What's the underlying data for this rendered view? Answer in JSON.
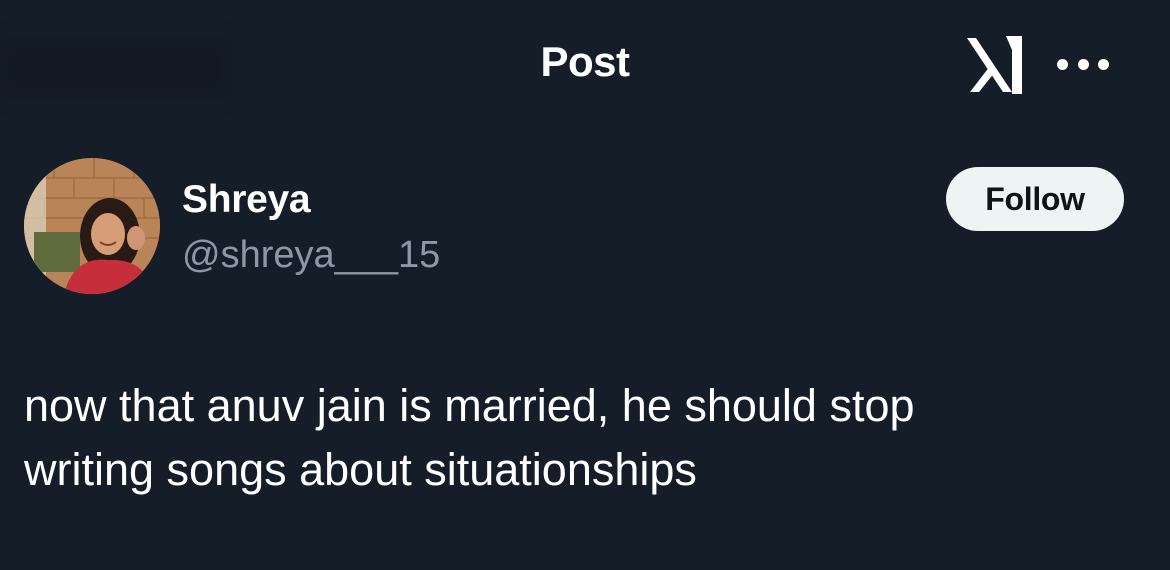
{
  "header": {
    "title": "Post",
    "logo_icon": "x-logo-icon",
    "more_icon": "more-options-icon"
  },
  "author": {
    "display_name": "Shreya",
    "handle": "@shreya___15",
    "avatar_icon": "profile-photo"
  },
  "actions": {
    "follow_label": "Follow"
  },
  "post": {
    "text_lines": [
      "now that anuv jain is married, he should stop",
      "writing songs about situationships"
    ]
  },
  "colors": {
    "background": "#151d29",
    "secondary_text": "#8b98a5",
    "follow_bg": "#eef3f4"
  }
}
